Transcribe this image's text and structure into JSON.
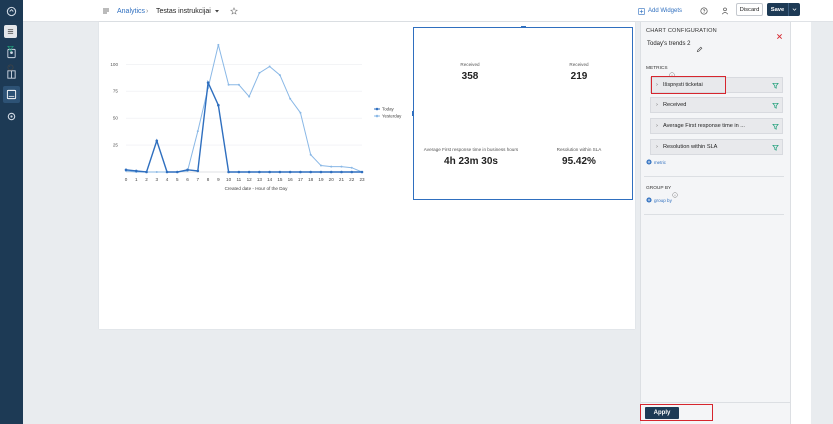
{
  "topbar": {
    "breadcrumb_root": "Analytics",
    "breadcrumb_separator": "›",
    "dashboard_name": "Testas instrukcijai",
    "add_widgets": "Add Widgets",
    "discard": "Discard",
    "save": "Save"
  },
  "chart_data": {
    "type": "line",
    "xlabel": "Created date - Hour of the Day",
    "x": [
      0,
      1,
      2,
      3,
      4,
      5,
      6,
      7,
      8,
      9,
      10,
      11,
      12,
      13,
      14,
      15,
      16,
      17,
      18,
      19,
      20,
      21,
      22,
      23
    ],
    "yticks": [
      25,
      50,
      75,
      100
    ],
    "ylim": [
      0,
      130
    ],
    "legend_position": "right",
    "series": [
      {
        "name": "Today",
        "color": "#2f6fbf",
        "values": [
          2,
          1,
          0,
          29,
          0,
          0,
          2,
          1,
          83,
          62,
          0,
          0,
          0,
          0,
          0,
          0,
          0,
          0,
          0,
          0,
          0,
          0,
          0,
          0
        ]
      },
      {
        "name": "Yesterday",
        "color": "#8ab8e6",
        "values": [
          1,
          0,
          0,
          0,
          0,
          0,
          1,
          38,
          78,
          118,
          81,
          81,
          70,
          92,
          98,
          90,
          68,
          55,
          16,
          6,
          5,
          5,
          4,
          0
        ]
      }
    ]
  },
  "metrics": [
    {
      "label": "Received",
      "value": "358"
    },
    {
      "label": "Received",
      "value": "219"
    },
    {
      "label": "Average First response time in business hours",
      "value": "4h 23m 30s"
    },
    {
      "label": "Resolution within SLA",
      "value": "95.42%"
    }
  ],
  "panel": {
    "title": "CHART CONFIGURATION",
    "chart_name": "Today's trends 2",
    "metrics_heading": "METRICS",
    "metric_items": [
      "Išspręsti ticketai",
      "Received",
      "Average First response time in ...",
      "Resolution within SLA"
    ],
    "add_metric": "metric",
    "group_by_heading": "GROUP BY",
    "add_group_by": "group by",
    "apply": "Apply"
  },
  "colors": {
    "nav": "#1d3a55",
    "accent": "#2f6fbf",
    "highlight": "#d6262e",
    "apply_bg": "#1d3a55"
  }
}
